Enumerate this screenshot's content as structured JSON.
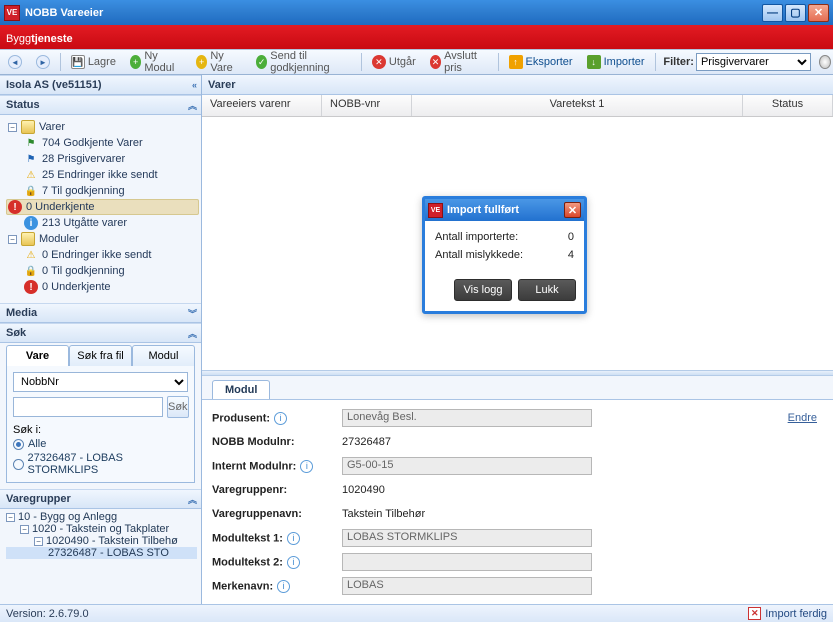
{
  "window": {
    "title": "NOBB Vareeier",
    "app_icon": "VE"
  },
  "brand": {
    "prefix": "Bygg",
    "bold": "tjeneste"
  },
  "toolbar": {
    "save": "Lagre",
    "ny_modul": "Ny Modul",
    "ny_vare": "Ny Vare",
    "send": "Send til godkjenning",
    "utgar": "Utgår",
    "avslutt": "Avslutt pris",
    "eksporter": "Eksporter",
    "importer": "Importer",
    "filter_label": "Filter:",
    "filter_value": "Prisgivervarer"
  },
  "left": {
    "owner": "Isola AS (ve51151)",
    "status_header": "Status",
    "media_header": "Media",
    "sok_header": "Søk",
    "varegrupper_header": "Varegrupper",
    "tree": {
      "varer": "Varer",
      "godkjente": "704 Godkjente Varer",
      "prisgiver": "28 Prisgivervarer",
      "endringer": "25 Endringer ikke sendt",
      "tilgodk": "7 Til godkjenning",
      "underkj": "0 Underkjente",
      "utgatte": "213 Utgåtte varer",
      "moduler": "Moduler",
      "m_endr": "0 Endringer ikke sendt",
      "m_tilg": "0 Til godkjenning",
      "m_under": "0 Underkjente"
    },
    "search": {
      "tab_vare": "Vare",
      "tab_fil": "Søk fra fil",
      "tab_modul": "Modul",
      "field": "NobbNr",
      "sok_btn": "Søk",
      "soki": "Søk i:",
      "r_alle": "Alle",
      "r_other": "27326487 - LOBAS STORMKLIPS"
    },
    "vg": {
      "n0": "10 - Bygg og Anlegg",
      "n1": "1020 - Takstein og Takplater",
      "n2": "1020490 - Takstein Tilbehø",
      "n3": "27326487 - LOBAS STO"
    }
  },
  "right": {
    "varer_header": "Varer",
    "cols": {
      "c1": "Vareeiers varenr",
      "c2": "NOBB-vnr",
      "c3": "Varetekst 1",
      "c4": "Status"
    },
    "modul_tab": "Modul",
    "form": {
      "produsent_l": "Produsent:",
      "produsent_v": "Lonevåg Besl.",
      "endre": "Endre",
      "nobbmodul_l": "NOBB Modulnr:",
      "nobbmodul_v": "27326487",
      "intmodul_l": "Internt Modulnr:",
      "intmodul_v": "G5-00-15",
      "vgnr_l": "Varegruppenr:",
      "vgnr_v": "1020490",
      "vgnavn_l": "Varegruppenavn:",
      "vgnavn_v": "Takstein Tilbehør",
      "mt1_l": "Modultekst 1:",
      "mt1_v": "LOBAS STORMKLIPS",
      "mt2_l": "Modultekst 2:",
      "mt2_v": "",
      "merke_l": "Merkenavn:",
      "merke_v": "LOBAS"
    }
  },
  "dialog": {
    "title": "Import fullført",
    "row1_k": "Antall importerte:",
    "row1_v": "0",
    "row2_k": "Antall mislykkede:",
    "row2_v": "4",
    "btn_log": "Vis logg",
    "btn_close": "Lukk"
  },
  "statusbar": {
    "version": "Version: 2.6.79.0",
    "right": "Import ferdig"
  }
}
